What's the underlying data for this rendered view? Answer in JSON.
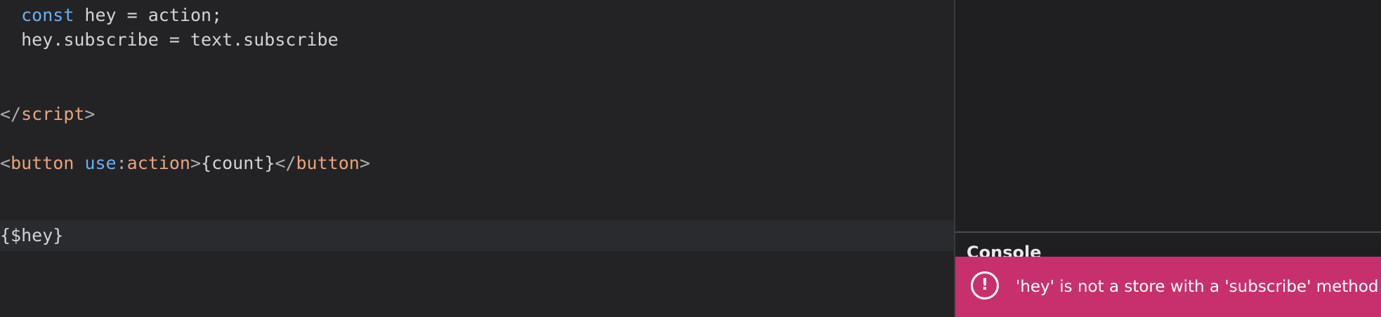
{
  "editor": {
    "lines": {
      "line1": {
        "indent": "  ",
        "keyword": "const",
        "rest": " hey = action;"
      },
      "line2": {
        "indent": "  ",
        "text": "hey.subscribe = text.subscribe"
      },
      "line5": {
        "open": "</",
        "tag": "script",
        "close": ">"
      },
      "line7": {
        "open": "<",
        "tag": "button",
        "space": " ",
        "attr": "use",
        "colon": ":",
        "attrval": "action",
        "close": ">",
        "content": "{count}",
        "endopen": "</",
        "endtag": "button",
        "endclose": ">"
      },
      "line8": {
        "text": "{$hey}"
      }
    }
  },
  "console": {
    "label": "Console"
  },
  "error": {
    "icon": "!",
    "message": "'hey' is not a store with a 'subscribe' method"
  },
  "colors": {
    "keyword": "#6ab0f3",
    "tag": "#e9a47d",
    "error_bg": "#c8306d"
  }
}
